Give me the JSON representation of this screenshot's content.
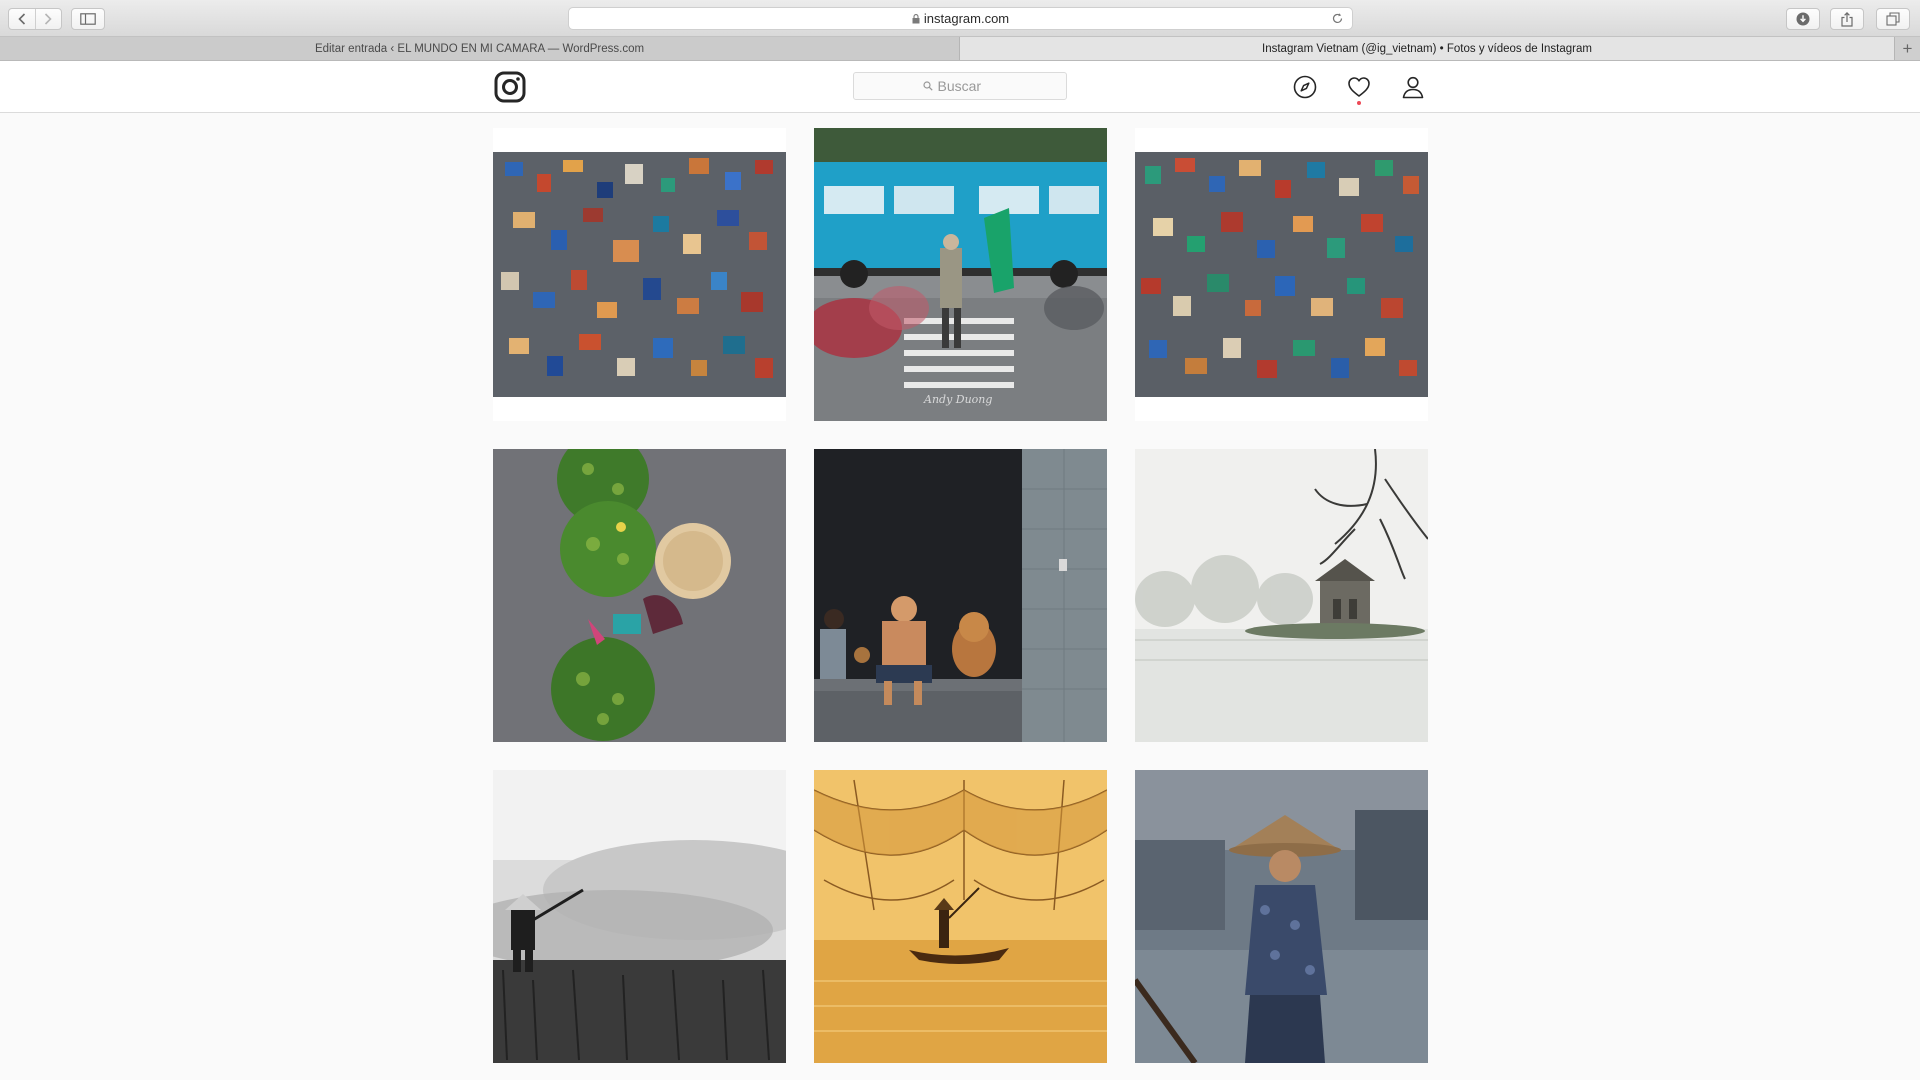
{
  "browser": {
    "url": "instagram.com",
    "tabs": [
      {
        "label": "Editar entrada ‹ EL MUNDO EN MI CAMARA — WordPress.com",
        "active": false
      },
      {
        "label": "Instagram Vietnam (@ig_vietnam) • Fotos y vídeos de Instagram",
        "active": true
      }
    ],
    "new_tab_glyph": "+"
  },
  "header": {
    "search_placeholder": "Buscar",
    "icons": [
      "instagram-logo-icon",
      "compass-icon",
      "heart-icon",
      "person-icon"
    ],
    "activity_dot_color": "#ed4956"
  },
  "posts": [
    {
      "subject": "motorbikes-aerial",
      "palette": [
        "#5a5f66",
        "#2f66b5",
        "#c4482e"
      ]
    },
    {
      "subject": "blue-bus-crosswalk",
      "palette": [
        "#1fa0c8",
        "#7a7d80",
        "#b02a3a"
      ],
      "watermark": "Andy Duong"
    },
    {
      "subject": "motorbikes-aerial",
      "palette": [
        "#5a5f66",
        "#2c9a7b",
        "#c94d35"
      ]
    },
    {
      "subject": "fruit-baskets",
      "palette": [
        "#6f6f73",
        "#3f7a2a",
        "#e1c9a1"
      ]
    },
    {
      "subject": "doorway-dog",
      "palette": [
        "#1f2125",
        "#7f8a90",
        "#d49a6a"
      ]
    },
    {
      "subject": "misty-lake-tower",
      "palette": [
        "#f0f0ee",
        "#b9bcb5",
        "#6c7a63"
      ]
    },
    {
      "subject": "farmer-bw",
      "palette": [
        "#f2f2f2",
        "#8c8c8c",
        "#222222"
      ]
    },
    {
      "subject": "fishing-nets",
      "palette": [
        "#f1c36a",
        "#c8892e",
        "#6a3e14"
      ]
    },
    {
      "subject": "woman-conical-hat",
      "palette": [
        "#3a4a6a",
        "#a38058",
        "#6e7a86"
      ]
    }
  ]
}
